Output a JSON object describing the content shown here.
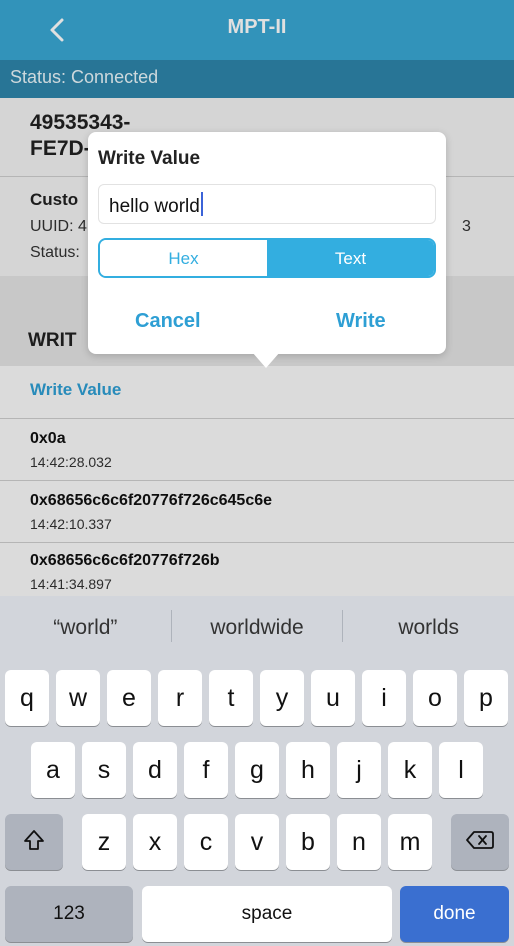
{
  "navbar": {
    "title": "MPT-II",
    "back_icon": "chevron-left-icon"
  },
  "status_bar": {
    "text": "Status: Connected"
  },
  "device": {
    "id_line1": "49535343-",
    "id_line2": "FE7D-"
  },
  "service": {
    "name": "Custo",
    "uuid": "UUID: 4",
    "status": "Status:",
    "uuid_tail": "3"
  },
  "section": {
    "heading": "WRIT"
  },
  "write_list": {
    "link": "Write Value",
    "rows": [
      {
        "value": "0x0a",
        "time": "14:42:28.032"
      },
      {
        "value": "0x68656c6c6f20776f726c645c6e",
        "time": "14:42:10.337"
      },
      {
        "value": "0x68656c6c6f20776f726b",
        "time": "14:41:34.897"
      }
    ]
  },
  "dialog": {
    "title": "Write Value",
    "input_value": "hello world",
    "segments": {
      "hex": "Hex",
      "text": "Text",
      "selected": "Text"
    },
    "cancel_label": "Cancel",
    "write_label": "Write"
  },
  "keyboard": {
    "suggestions": [
      "“world”",
      "worldwide",
      "worlds"
    ],
    "row1": [
      "q",
      "w",
      "e",
      "r",
      "t",
      "y",
      "u",
      "i",
      "o",
      "p"
    ],
    "row2": [
      "a",
      "s",
      "d",
      "f",
      "g",
      "h",
      "j",
      "k",
      "l"
    ],
    "row3": [
      "z",
      "x",
      "c",
      "v",
      "b",
      "n",
      "m"
    ],
    "numbers_label": "123",
    "space_label": "space",
    "done_label": "done",
    "shift_icon": "shift-icon",
    "delete_icon": "backspace-icon"
  },
  "colors": {
    "nav": "#3aa8d4",
    "status": "#2e86ab",
    "accent": "#2e9fd4",
    "done": "#3a6fd0"
  }
}
